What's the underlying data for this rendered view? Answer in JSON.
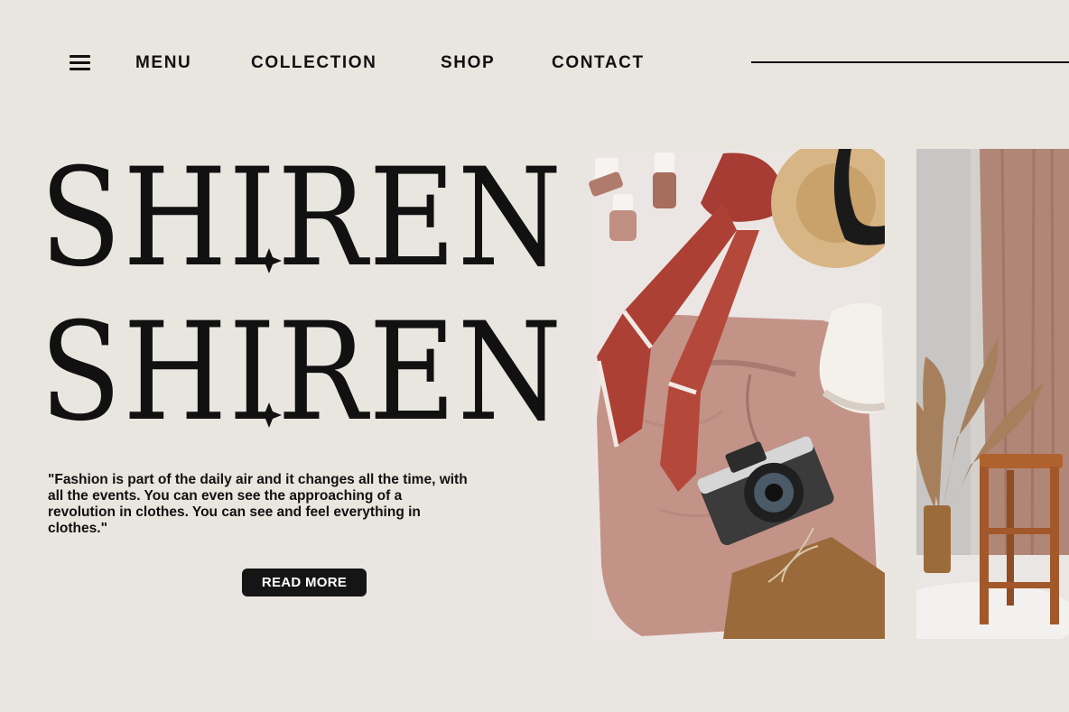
{
  "nav": {
    "menu_label": "MENU",
    "collection_label": "COLLECTION",
    "shop_label": "SHOP",
    "contact_label": "CONTACT",
    "menu_icon": "hamburger-icon"
  },
  "hero": {
    "title_line_1": "SHIREN",
    "title_line_2": "SHIREN",
    "quote": "\"Fashion is part of the daily air and it changes all the time, with all the events. You can even see the approaching of a revolution in clothes. You can see and feel everything in clothes.\"",
    "cta_label": "READ MORE"
  },
  "colors": {
    "background": "#e9e5df",
    "text": "#111111",
    "button": "#151515",
    "accent_pink": "#c4958a",
    "accent_red": "#a43a30"
  }
}
